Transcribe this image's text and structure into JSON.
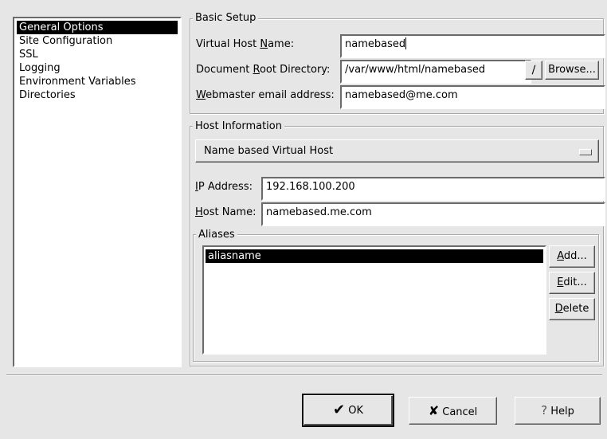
{
  "sidebar": {
    "items": [
      {
        "label": "General Options",
        "selected": true
      },
      {
        "label": "Site Configuration",
        "selected": false
      },
      {
        "label": "SSL",
        "selected": false
      },
      {
        "label": "Logging",
        "selected": false
      },
      {
        "label": "Environment Variables",
        "selected": false
      },
      {
        "label": "Directories",
        "selected": false
      }
    ]
  },
  "basic_setup": {
    "title": "Basic Setup",
    "vhost_label_pre": "Virtual Host ",
    "vhost_label_key": "N",
    "vhost_label_post": "ame:",
    "vhost_value": "namebased",
    "docroot_label_pre": "Document ",
    "docroot_label_key": "R",
    "docroot_label_post": "oot Directory:",
    "docroot_value": "/var/www/html/namebased",
    "browse_label": "Browse...",
    "webmaster_label_key": "W",
    "webmaster_label_post": "ebmaster email address:",
    "webmaster_value": "namebased@me.com"
  },
  "host_info": {
    "title": "Host Information",
    "type_selected": "Name based Virtual Host",
    "ip_label_key": "I",
    "ip_label_post": "P Address:",
    "ip_value": "192.168.100.200",
    "host_label_key": "H",
    "host_label_post": "ost Name:",
    "host_value": "namebased.me.com"
  },
  "aliases": {
    "title": "Aliases",
    "items": [
      {
        "label": "aliasname",
        "selected": true
      }
    ],
    "add_key": "A",
    "add_post": "dd...",
    "edit_key": "E",
    "edit_post": "dit...",
    "delete_key": "D",
    "delete_post": "elete"
  },
  "footer": {
    "ok_label": "OK",
    "cancel_label": "Cancel",
    "help_label": "Help"
  }
}
